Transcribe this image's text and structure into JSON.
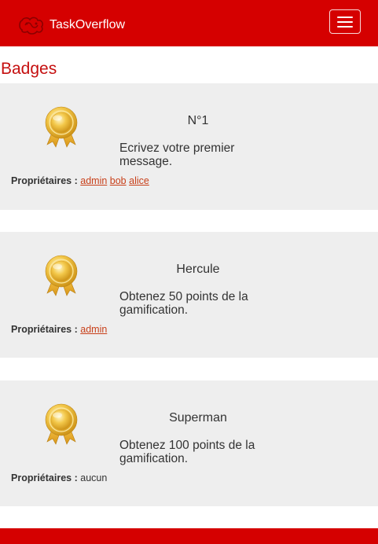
{
  "navbar": {
    "brand_name": "TaskOverflow",
    "logo_icon": "taskoverflow-logo",
    "menu_icon": "hamburger-icon",
    "background": "#d50000"
  },
  "page": {
    "title": "Badges",
    "title_color": "#c50f0f"
  },
  "badges": [
    {
      "icon": "medal-icon",
      "name": "N°1",
      "description": "Ecrivez votre premier message.",
      "owners_label": "Propriétaires :",
      "owners": [
        "admin",
        "bob",
        "alice"
      ]
    },
    {
      "icon": "medal-icon",
      "name": "Hercule",
      "description": "Obtenez 50 points de la gamification.",
      "owners_label": "Propriétaires :",
      "owners": [
        "admin"
      ]
    },
    {
      "icon": "medal-icon",
      "name": "Superman",
      "description": "Obtenez 100 points de la gamification.",
      "owners_label": "Propriétaires :",
      "owners": [],
      "no_owner_text": "aucun"
    }
  ],
  "colors": {
    "card_background": "#eeeeee",
    "link": "#c8401a",
    "footer": "#d50000"
  }
}
